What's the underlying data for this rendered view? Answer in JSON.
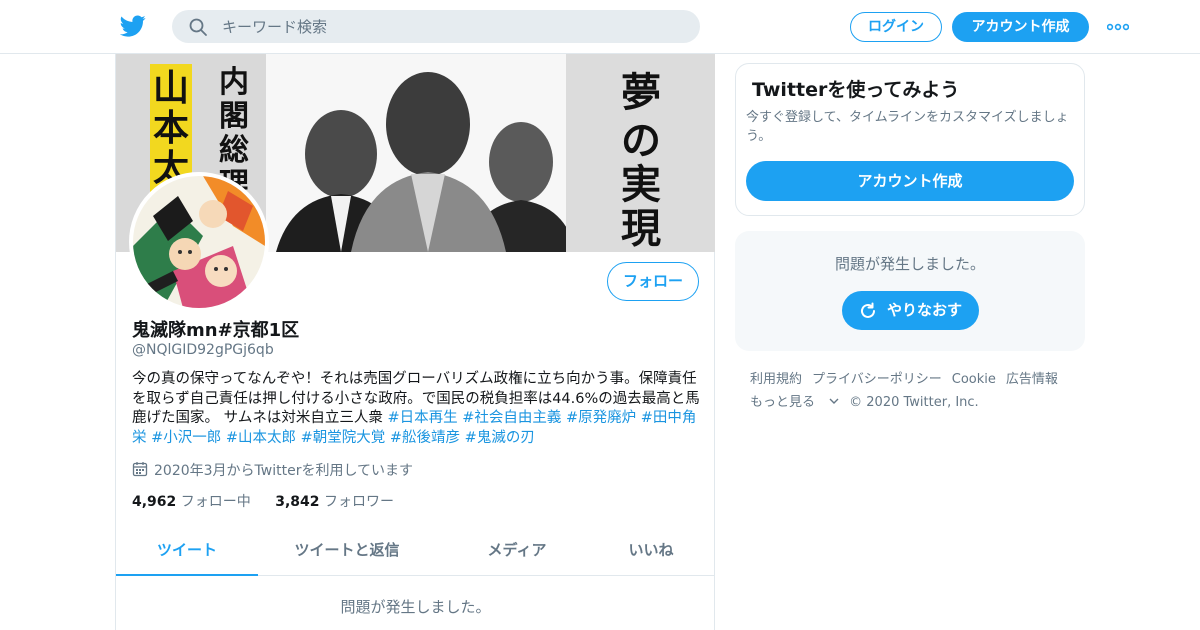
{
  "topbar": {
    "search_placeholder": "キーワード検索",
    "login_label": "ログイン",
    "signup_label": "アカウント作成",
    "accent_color": "#1da1f2"
  },
  "banner": {
    "left_strip_text": "山本太郎",
    "left_title_text": "内閣総理",
    "right_text": "夢の実現"
  },
  "profile": {
    "name": "鬼滅隊mn#京都1区",
    "handle": "@NQlGID92gPGj6qb",
    "follow_label": "フォロー",
    "bio_text": "今の真の保守ってなんぞや！それは売国グローバリズム政権に立ち向かう事。保障責任を取らず自己責任は押し付ける小さな政府。で国民の税負担率は44.6%の過去最高と馬鹿げた国家。 サムネは対米自立三人衆 ",
    "bio_hashtags": [
      "#日本再生",
      "#社会自由主義",
      "#原発廃炉",
      "#田中角栄",
      "#小沢一郎",
      "#山本太郎",
      "#朝堂院大覚",
      "#舩後靖彦",
      "#鬼滅の刃"
    ],
    "joined": "2020年3月からTwitterを利用しています",
    "following_count": "4,962",
    "following_label": "フォロー中",
    "followers_count": "3,842",
    "followers_label": "フォロワー"
  },
  "tabs": [
    {
      "label": "ツイート",
      "active": true
    },
    {
      "label": "ツイートと返信",
      "active": false
    },
    {
      "label": "メディア",
      "active": false
    },
    {
      "label": "いいね",
      "active": false
    }
  ],
  "timeline": {
    "error_text": "問題が発生しました。"
  },
  "signup_card": {
    "title": "Twitterを使ってみよう",
    "description": "今すぐ登録して、タイムラインをカスタマイズしましょう。",
    "button_label": "アカウント作成"
  },
  "error_card": {
    "text": "問題が発生しました。",
    "retry_label": "やりなおす"
  },
  "footer": {
    "links": [
      "利用規約",
      "プライバシーポリシー",
      "Cookie",
      "広告情報"
    ],
    "more_label": "もっと見る",
    "copyright": "© 2020 Twitter, Inc."
  }
}
